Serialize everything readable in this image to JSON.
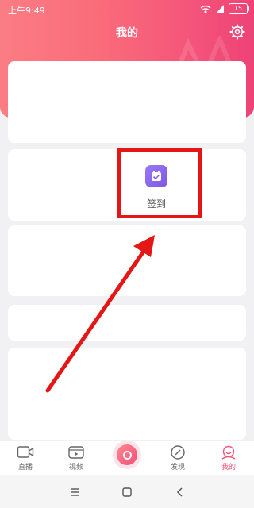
{
  "status_bar": {
    "time": "上午9:49",
    "battery": "15"
  },
  "header": {
    "title": "我的"
  },
  "feature": {
    "signin_label": "签到"
  },
  "tabbar": {
    "tabs": [
      {
        "label": "直播",
        "icon": "tv-icon"
      },
      {
        "label": "视频",
        "icon": "video-icon"
      },
      {
        "label": "",
        "icon": "camera-icon"
      },
      {
        "label": "发现",
        "icon": "compass-icon"
      },
      {
        "label": "我的",
        "icon": "profile-icon"
      }
    ],
    "active_color": "#f4557a"
  },
  "colors": {
    "accent": "#f4557a",
    "highlight": "#e41616",
    "signin_icon": "#8b66ee"
  }
}
